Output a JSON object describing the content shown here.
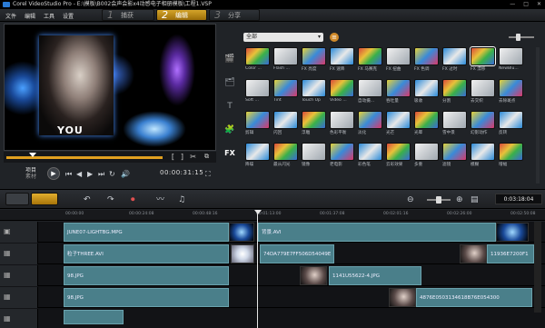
{
  "app": {
    "title": "Corel VideoStudio Pro - E:\\模板\\B002会声会影x4动感电子相册模板\\工程1.VSP"
  },
  "window_buttons": [
    "—",
    "□",
    "✕"
  ],
  "menu": [
    "文件",
    "编辑",
    "工具",
    "设置"
  ],
  "steps": [
    {
      "num": "1",
      "label": "捕获"
    },
    {
      "num": "2",
      "label": "编辑"
    },
    {
      "num": "3",
      "label": "分享"
    }
  ],
  "preview": {
    "overlay_text": "YOU"
  },
  "transport": {
    "project_label": "项目",
    "clip_label": "素材",
    "timecode": "00:00:31:15",
    "bracket_in": "[",
    "bracket_out": "]"
  },
  "library": {
    "category": "全部",
    "category_arrow": "▾",
    "side_tabs": [
      "🎬",
      "🗂",
      "T",
      "🧩",
      "FX"
    ],
    "items": [
      [
        "Color ...",
        "Flash ...",
        "FX 亮度",
        "FX 速降",
        "FX 马赛克",
        "FX 扭曲",
        "FX 色调",
        "FX 过时",
        "FX 漂移",
        "NewBlu..."
      ],
      [
        "Soft ...",
        "Tint",
        "Touch Up",
        "Video ...",
        "自动摄...",
        "吞吐量",
        "吸收",
        "分割",
        "去交织",
        "去除斑点"
      ],
      [
        "剪辑",
        "闪回",
        "浮雕",
        "色彩平衡",
        "淡化",
        "光芒",
        "光晕",
        "雪中景",
        "幻影动作",
        "反转"
      ],
      [
        "降噪",
        "最从闪光",
        "镜像",
        "老电影",
        "彩色笔",
        "云彩效果",
        "多重",
        "滤镜",
        "模糊",
        "增幅"
      ]
    ],
    "selected": "FX 漂移"
  },
  "timeline": {
    "timecode": "0:03:18:04",
    "ruler_ticks": [
      "00:00:00",
      "00:00:24:08",
      "00:00:48:16",
      "00:01:13:00",
      "00:01:37:08",
      "00:02:01:16",
      "00:02:26:00",
      "00:02:50:08"
    ],
    "tracks": [
      {
        "clips": [
          {
            "label": "JUNE07-LIGHTBG.MPG",
            "kind": "video"
          },
          {
            "label": "背景.AVI",
            "kind": "video"
          }
        ]
      },
      {
        "clips": [
          {
            "label": "粒子THREE.AVI",
            "kind": "video"
          },
          {
            "label": "74DA779E7FF506D54049E",
            "kind": "img"
          },
          {
            "label": "11936E7200F1",
            "kind": "img"
          }
        ]
      },
      {
        "clips": [
          {
            "label": "98.JPG",
            "kind": "video"
          },
          {
            "label": "1141U55622-4.JPG",
            "kind": "img"
          }
        ]
      },
      {
        "clips": [
          {
            "label": "98.JPG",
            "kind": "video"
          },
          {
            "label": "4876E0503134618B76E054300",
            "kind": "img"
          }
        ]
      }
    ]
  },
  "colors": {
    "accent": "#d9a22a",
    "clip": "#4a7f8a",
    "background": "#202327"
  }
}
